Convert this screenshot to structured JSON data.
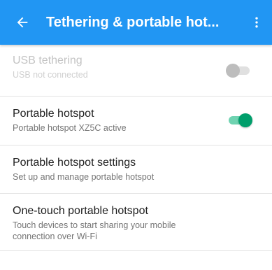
{
  "appbar": {
    "title": "Tethering & portable hot...",
    "back_icon": "arrow-left-icon",
    "menu_icon": "more-vert-icon",
    "color": "#2196f3"
  },
  "settings": [
    {
      "title": "USB tethering",
      "subtitle": "USB not connected",
      "enabled": false,
      "switch": "off"
    },
    {
      "title": "Portable hotspot",
      "subtitle": "Portable hotspot XZ5C active",
      "enabled": true,
      "switch": "on"
    },
    {
      "title": "Portable hotspot settings",
      "subtitle": "Set up and manage portable hotspot",
      "enabled": true
    },
    {
      "title": "One-touch portable hotspot",
      "subtitle_line1": "Touch devices to start sharing your mobile",
      "subtitle_line2": "connection over Wi-Fi",
      "enabled": true
    }
  ],
  "colors": {
    "switch_on_thumb": "#009e6b",
    "switch_on_track": "#6fd3b1",
    "switch_off_thumb": "#bdbdbd"
  }
}
